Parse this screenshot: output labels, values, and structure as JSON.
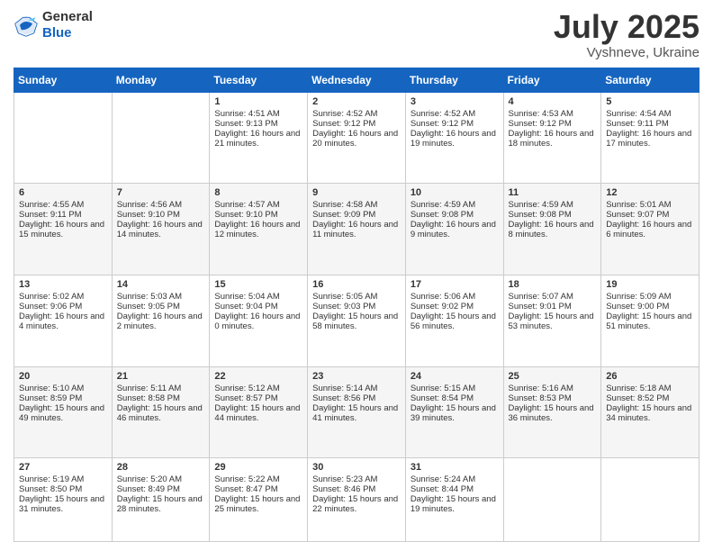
{
  "header": {
    "logo_general": "General",
    "logo_blue": "Blue",
    "month_title": "July 2025",
    "location": "Vyshneve, Ukraine"
  },
  "days_of_week": [
    "Sunday",
    "Monday",
    "Tuesday",
    "Wednesday",
    "Thursday",
    "Friday",
    "Saturday"
  ],
  "weeks": [
    [
      {
        "day": "",
        "info": ""
      },
      {
        "day": "",
        "info": ""
      },
      {
        "day": "1",
        "info": "Sunrise: 4:51 AM\nSunset: 9:13 PM\nDaylight: 16 hours and 21 minutes."
      },
      {
        "day": "2",
        "info": "Sunrise: 4:52 AM\nSunset: 9:12 PM\nDaylight: 16 hours and 20 minutes."
      },
      {
        "day": "3",
        "info": "Sunrise: 4:52 AM\nSunset: 9:12 PM\nDaylight: 16 hours and 19 minutes."
      },
      {
        "day": "4",
        "info": "Sunrise: 4:53 AM\nSunset: 9:12 PM\nDaylight: 16 hours and 18 minutes."
      },
      {
        "day": "5",
        "info": "Sunrise: 4:54 AM\nSunset: 9:11 PM\nDaylight: 16 hours and 17 minutes."
      }
    ],
    [
      {
        "day": "6",
        "info": "Sunrise: 4:55 AM\nSunset: 9:11 PM\nDaylight: 16 hours and 15 minutes."
      },
      {
        "day": "7",
        "info": "Sunrise: 4:56 AM\nSunset: 9:10 PM\nDaylight: 16 hours and 14 minutes."
      },
      {
        "day": "8",
        "info": "Sunrise: 4:57 AM\nSunset: 9:10 PM\nDaylight: 16 hours and 12 minutes."
      },
      {
        "day": "9",
        "info": "Sunrise: 4:58 AM\nSunset: 9:09 PM\nDaylight: 16 hours and 11 minutes."
      },
      {
        "day": "10",
        "info": "Sunrise: 4:59 AM\nSunset: 9:08 PM\nDaylight: 16 hours and 9 minutes."
      },
      {
        "day": "11",
        "info": "Sunrise: 4:59 AM\nSunset: 9:08 PM\nDaylight: 16 hours and 8 minutes."
      },
      {
        "day": "12",
        "info": "Sunrise: 5:01 AM\nSunset: 9:07 PM\nDaylight: 16 hours and 6 minutes."
      }
    ],
    [
      {
        "day": "13",
        "info": "Sunrise: 5:02 AM\nSunset: 9:06 PM\nDaylight: 16 hours and 4 minutes."
      },
      {
        "day": "14",
        "info": "Sunrise: 5:03 AM\nSunset: 9:05 PM\nDaylight: 16 hours and 2 minutes."
      },
      {
        "day": "15",
        "info": "Sunrise: 5:04 AM\nSunset: 9:04 PM\nDaylight: 16 hours and 0 minutes."
      },
      {
        "day": "16",
        "info": "Sunrise: 5:05 AM\nSunset: 9:03 PM\nDaylight: 15 hours and 58 minutes."
      },
      {
        "day": "17",
        "info": "Sunrise: 5:06 AM\nSunset: 9:02 PM\nDaylight: 15 hours and 56 minutes."
      },
      {
        "day": "18",
        "info": "Sunrise: 5:07 AM\nSunset: 9:01 PM\nDaylight: 15 hours and 53 minutes."
      },
      {
        "day": "19",
        "info": "Sunrise: 5:09 AM\nSunset: 9:00 PM\nDaylight: 15 hours and 51 minutes."
      }
    ],
    [
      {
        "day": "20",
        "info": "Sunrise: 5:10 AM\nSunset: 8:59 PM\nDaylight: 15 hours and 49 minutes."
      },
      {
        "day": "21",
        "info": "Sunrise: 5:11 AM\nSunset: 8:58 PM\nDaylight: 15 hours and 46 minutes."
      },
      {
        "day": "22",
        "info": "Sunrise: 5:12 AM\nSunset: 8:57 PM\nDaylight: 15 hours and 44 minutes."
      },
      {
        "day": "23",
        "info": "Sunrise: 5:14 AM\nSunset: 8:56 PM\nDaylight: 15 hours and 41 minutes."
      },
      {
        "day": "24",
        "info": "Sunrise: 5:15 AM\nSunset: 8:54 PM\nDaylight: 15 hours and 39 minutes."
      },
      {
        "day": "25",
        "info": "Sunrise: 5:16 AM\nSunset: 8:53 PM\nDaylight: 15 hours and 36 minutes."
      },
      {
        "day": "26",
        "info": "Sunrise: 5:18 AM\nSunset: 8:52 PM\nDaylight: 15 hours and 34 minutes."
      }
    ],
    [
      {
        "day": "27",
        "info": "Sunrise: 5:19 AM\nSunset: 8:50 PM\nDaylight: 15 hours and 31 minutes."
      },
      {
        "day": "28",
        "info": "Sunrise: 5:20 AM\nSunset: 8:49 PM\nDaylight: 15 hours and 28 minutes."
      },
      {
        "day": "29",
        "info": "Sunrise: 5:22 AM\nSunset: 8:47 PM\nDaylight: 15 hours and 25 minutes."
      },
      {
        "day": "30",
        "info": "Sunrise: 5:23 AM\nSunset: 8:46 PM\nDaylight: 15 hours and 22 minutes."
      },
      {
        "day": "31",
        "info": "Sunrise: 5:24 AM\nSunset: 8:44 PM\nDaylight: 15 hours and 19 minutes."
      },
      {
        "day": "",
        "info": ""
      },
      {
        "day": "",
        "info": ""
      }
    ]
  ]
}
